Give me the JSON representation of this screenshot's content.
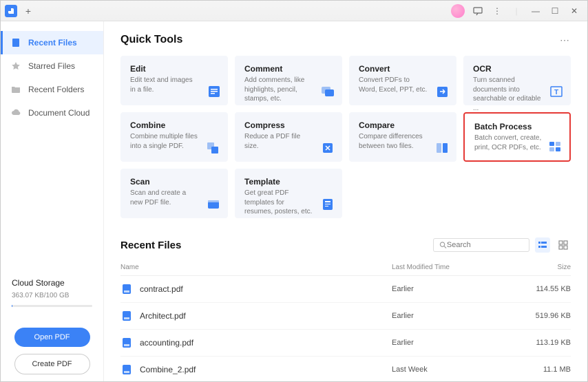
{
  "sidebar": {
    "items": [
      {
        "label": "Recent Files",
        "active": true
      },
      {
        "label": "Starred Files",
        "active": false
      },
      {
        "label": "Recent Folders",
        "active": false
      },
      {
        "label": "Document Cloud",
        "active": false
      }
    ],
    "storage": {
      "title": "Cloud Storage",
      "usage": "363.07 KB/100 GB"
    },
    "open_btn": "Open PDF",
    "create_btn": "Create PDF"
  },
  "quick_tools": {
    "title": "Quick Tools",
    "tools": [
      {
        "title": "Edit",
        "desc": "Edit text and images in a file."
      },
      {
        "title": "Comment",
        "desc": "Add comments, like highlights, pencil, stamps, etc."
      },
      {
        "title": "Convert",
        "desc": "Convert PDFs to Word, Excel, PPT, etc."
      },
      {
        "title": "OCR",
        "desc": "Turn scanned documents into searchable or editable ..."
      },
      {
        "title": "Combine",
        "desc": "Combine multiple files into a single PDF."
      },
      {
        "title": "Compress",
        "desc": "Reduce a PDF file size."
      },
      {
        "title": "Compare",
        "desc": "Compare differences between two files."
      },
      {
        "title": "Batch Process",
        "desc": "Batch convert, create, print, OCR PDFs, etc."
      },
      {
        "title": "Scan",
        "desc": "Scan and create a new PDF file."
      },
      {
        "title": "Template",
        "desc": "Get great PDF templates for resumes, posters, etc."
      }
    ]
  },
  "recent": {
    "title": "Recent Files",
    "search_placeholder": "Search",
    "columns": {
      "name": "Name",
      "time": "Last Modified Time",
      "size": "Size"
    },
    "files": [
      {
        "name": "contract.pdf",
        "time": "Earlier",
        "size": "114.55 KB"
      },
      {
        "name": "Architect.pdf",
        "time": "Earlier",
        "size": "519.96 KB"
      },
      {
        "name": "accounting.pdf",
        "time": "Earlier",
        "size": "113.19 KB"
      },
      {
        "name": "Combine_2.pdf",
        "time": "Last Week",
        "size": "11.1 MB"
      }
    ]
  }
}
